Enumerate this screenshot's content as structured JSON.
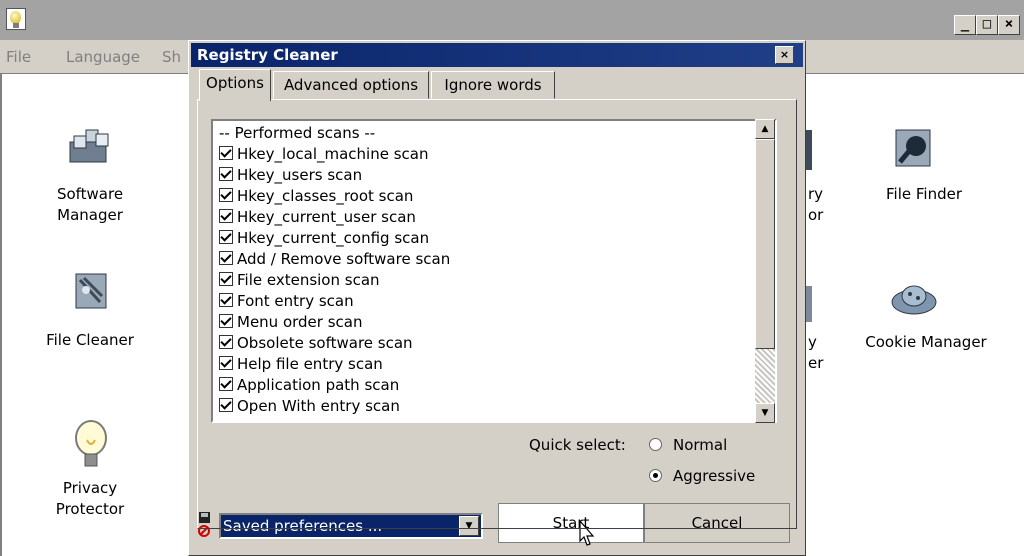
{
  "main_window": {
    "menu": [
      "File",
      "Language",
      "Sh"
    ],
    "buttons": {
      "minimize": "_",
      "maximize": "□",
      "close": "×"
    },
    "apps_left": [
      {
        "line1": "Software",
        "line2": "Manager",
        "icon": "software-manager-icon"
      },
      {
        "line1": "File Cleaner",
        "line2": "",
        "icon": "file-cleaner-icon"
      },
      {
        "line1": "Privacy",
        "line2": "Protector",
        "icon": "privacy-protector-icon"
      }
    ],
    "apps_partial": [
      {
        "line1": "ry",
        "line2": "or"
      },
      {
        "line1": "y",
        "line2": "er"
      }
    ],
    "apps_right": [
      {
        "label": "File Finder",
        "icon": "file-finder-icon"
      },
      {
        "label": "Cookie Manager",
        "icon": "cookie-manager-icon"
      }
    ]
  },
  "dialog": {
    "title": "Registry Cleaner",
    "close": "×",
    "tabs": [
      "Options",
      "Advanced options",
      "Ignore words"
    ],
    "scan_header": "-- Performed scans --",
    "scans": [
      "Hkey_local_machine scan",
      "Hkey_users scan",
      "Hkey_classes_root scan",
      "Hkey_current_user scan",
      "Hkey_current_config scan",
      "Add / Remove software scan",
      "File extension scan",
      "Font entry scan",
      "Menu order scan",
      "Obsolete software scan",
      "Help file entry scan",
      "Application path scan",
      "Open With entry scan"
    ],
    "quick_select_label": "Quick select:",
    "quick_options": [
      "Normal",
      "Aggressive"
    ],
    "quick_selected": "Aggressive",
    "prefs_value": "Saved preferences ...",
    "start_label": "Start",
    "cancel_label": "Cancel",
    "scroll_up": "▲",
    "scroll_down": "▼",
    "dropdown_arrow": "▼"
  }
}
